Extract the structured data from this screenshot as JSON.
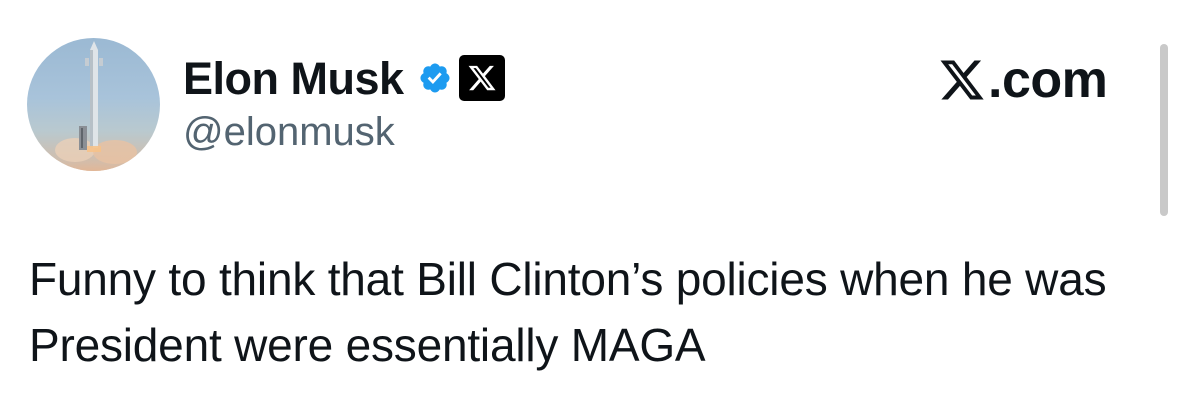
{
  "author": {
    "display_name": "Elon Musk",
    "handle": "@elonmusk",
    "avatar": "rocket-launch-avatar",
    "verified_icon": "verified-badge-icon",
    "affiliation_icon": "x-logo-icon"
  },
  "header": {
    "site_label": ".com",
    "site_icon": "x-logo-icon"
  },
  "tweet": {
    "text": "Funny to think that Bill Clinton’s policies when he was President were essentially MAGA"
  },
  "colors": {
    "verified": "#1d9bf0",
    "text_primary": "#0f1419",
    "text_secondary": "#536471",
    "scrollbar": "#c9c9c9"
  }
}
